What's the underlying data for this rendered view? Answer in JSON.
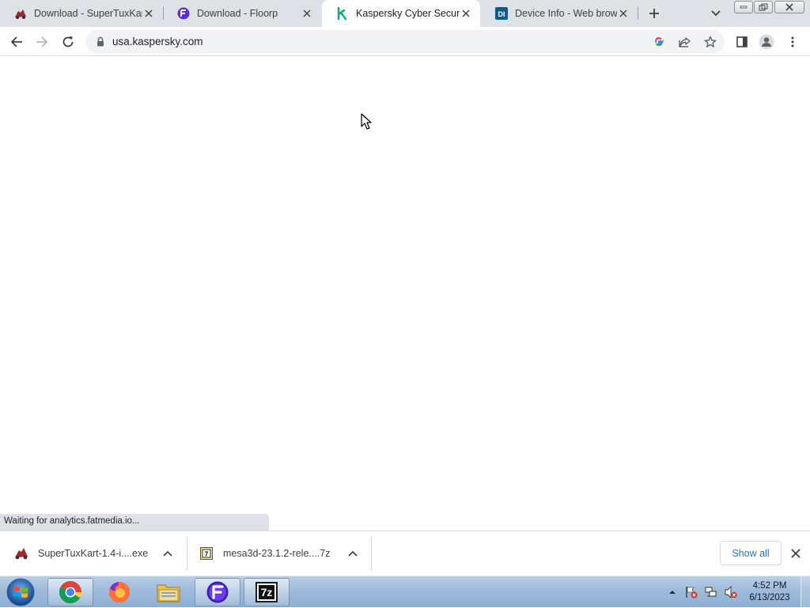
{
  "tabs": [
    {
      "title": "Download - SuperTuxKart",
      "icon": "supertuxkart-icon",
      "active": false
    },
    {
      "title": "Download - Floorp",
      "icon": "floorp-icon",
      "active": false
    },
    {
      "title": "Kaspersky Cyber Security",
      "icon": "kaspersky-icon",
      "active": true
    },
    {
      "title": "Device Info - Web browse",
      "icon": "device-info-icon",
      "active": false
    }
  ],
  "address_bar": {
    "url": "usa.kaspersky.com"
  },
  "status_bubble": {
    "text": "Waiting for analytics.fatmedia.io..."
  },
  "downloads": [
    {
      "name": "SuperTuxKart-1.4-i....exe",
      "icon": "supertuxkart-icon"
    },
    {
      "name": "mesa3d-23.1.2-rele....7z",
      "icon": "7zip-file-icon"
    }
  ],
  "download_shelf": {
    "show_all_label": "Show all"
  },
  "taskbar": {
    "apps": [
      "chrome",
      "firefox",
      "file-explorer",
      "floorp",
      "7zip"
    ],
    "clock_time": "4:52 PM",
    "clock_date": "6/13/2023"
  },
  "colors": {
    "accent": "#1a73e8",
    "tabstrip": "#dee1e6",
    "taskbar": "#9fbbdb"
  }
}
